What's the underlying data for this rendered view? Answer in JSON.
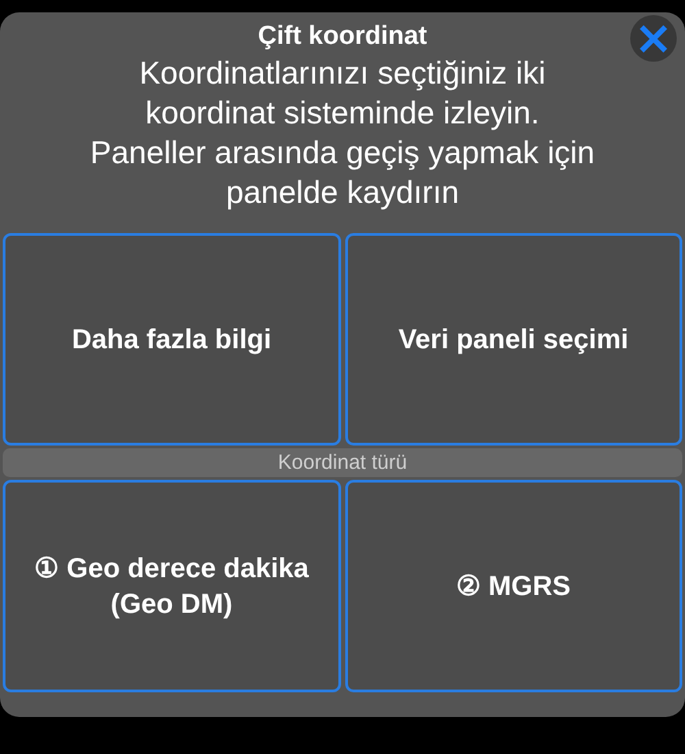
{
  "dialog": {
    "title": "Çift koordinat",
    "description": "Koordinatlarınızı seçtiğiniz iki koordinat sisteminde izleyin. Paneller arasında geçiş yapmak için panelde kaydırın",
    "close_button": "×"
  },
  "top_buttons": [
    {
      "label": "Daha fazla bilgi"
    },
    {
      "label": "Veri paneli seçimi"
    }
  ],
  "section_label": "Koordinat türü",
  "coordinate_buttons": [
    {
      "label": "① Geo derece dakika (Geo DM)"
    },
    {
      "label": "② MGRS"
    }
  ]
}
